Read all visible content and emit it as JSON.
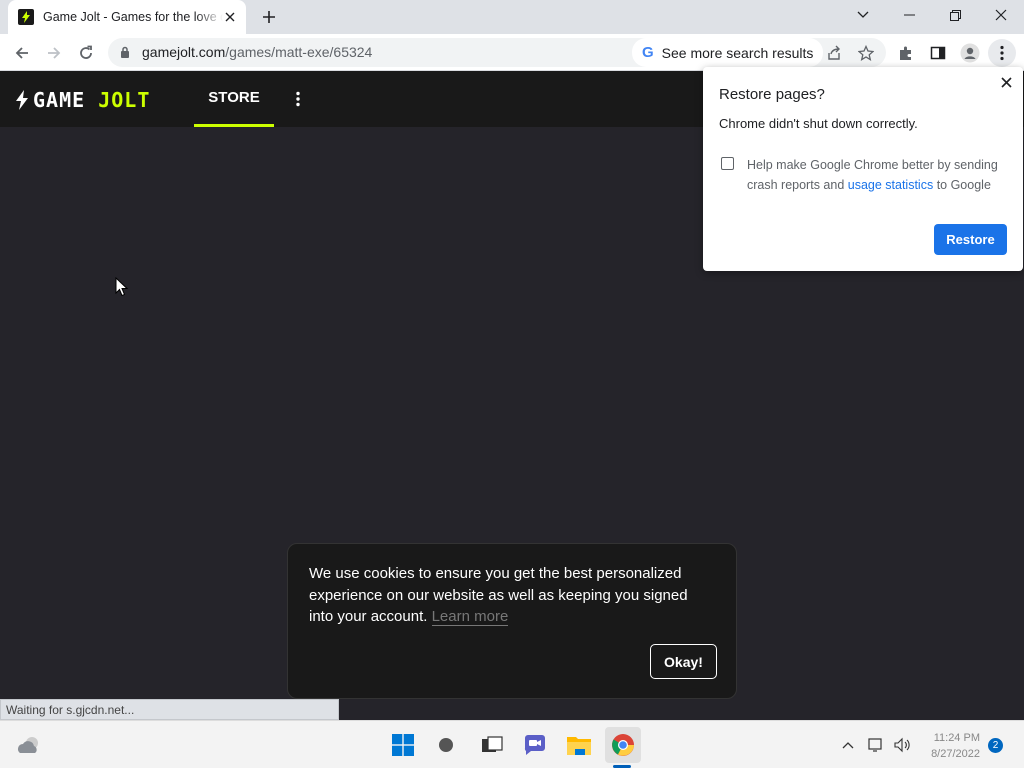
{
  "browser": {
    "tab_title": "Game Jolt - Games for the love of it",
    "url_host": "gamejolt.com",
    "url_path": "/games/matt-exe/65324",
    "search_hint": "See more search results",
    "status_text": "Waiting for s.gjcdn.net..."
  },
  "site": {
    "logo_game": "GAME",
    "logo_jolt": "JOLT",
    "nav_store": "STORE",
    "accent_color": "#ccff00"
  },
  "restore_dialog": {
    "title": "Restore pages?",
    "message": "Chrome didn't shut down correctly.",
    "help_prefix": "Help make Google Chrome better by sending crash reports and ",
    "help_link": "usage statistics",
    "help_suffix": " to Google",
    "checkbox_checked": false,
    "button_label": "Restore"
  },
  "cookie_banner": {
    "text": "We use cookies to ensure you get the best personalized experience on our website as well as keeping you signed into your account. ",
    "learn_more": "Learn more",
    "button_label": "Okay!"
  },
  "taskbar": {
    "time": "11:24 PM",
    "date": "8/27/2022",
    "notification_count": "2"
  }
}
